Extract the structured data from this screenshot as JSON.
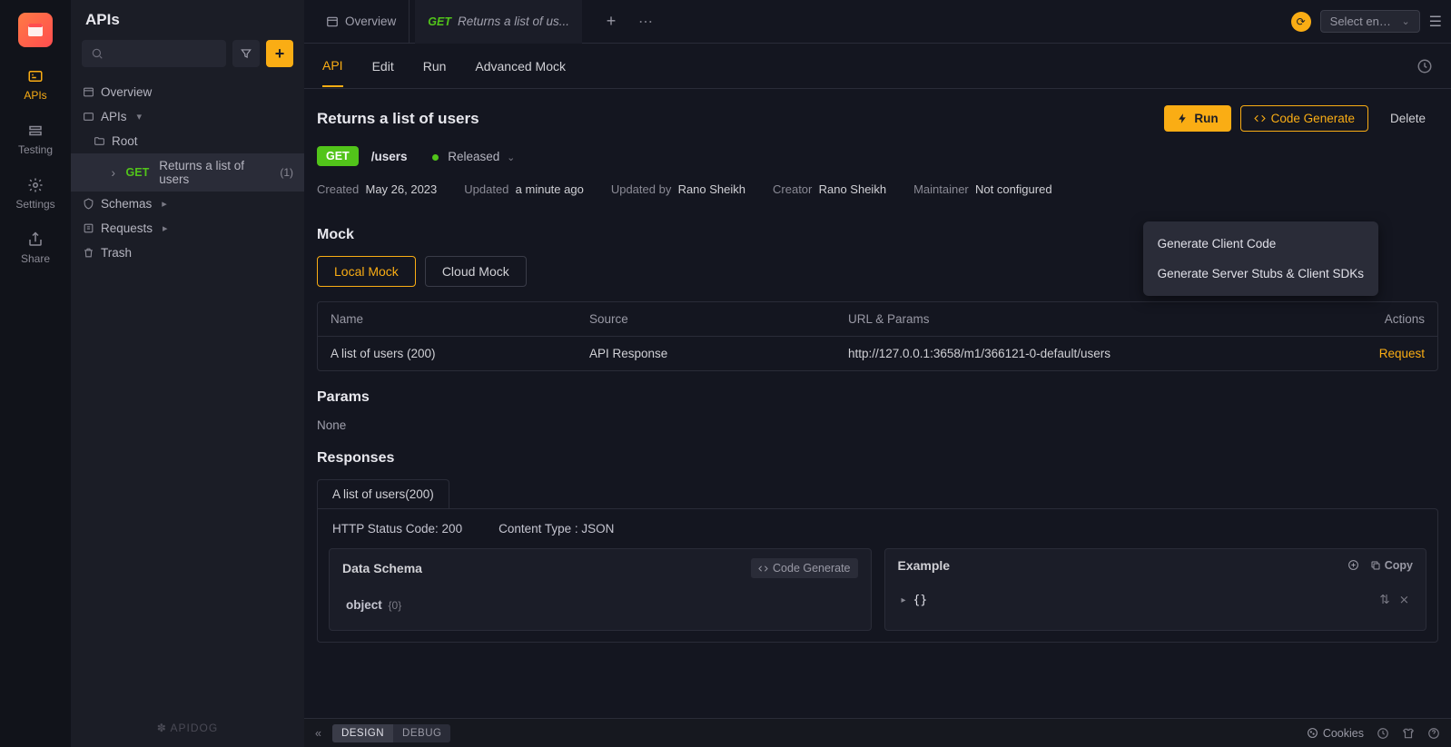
{
  "rail": {
    "items": [
      {
        "label": "APIs",
        "icon": "api"
      },
      {
        "label": "Testing",
        "icon": "testing"
      },
      {
        "label": "Settings",
        "icon": "settings"
      },
      {
        "label": "Share",
        "icon": "share"
      }
    ]
  },
  "sidebar": {
    "title": "APIs",
    "search_placeholder": "",
    "overview": "Overview",
    "apis": "APIs",
    "root": "Root",
    "endpoint_method": "GET",
    "endpoint_name": "Returns a list of users",
    "endpoint_count": "(1)",
    "schemas": "Schemas",
    "requests": "Requests",
    "trash": "Trash",
    "brand": "APIDOG"
  },
  "tabs": {
    "overview": "Overview",
    "active_method": "GET",
    "active_title": "Returns a list of us...",
    "env_placeholder": "Select envir..."
  },
  "subtabs": {
    "api": "API",
    "edit": "Edit",
    "run": "Run",
    "mock": "Advanced Mock"
  },
  "page": {
    "title": "Returns a list of users",
    "run_btn": "Run",
    "codegen_btn": "Code Generate",
    "delete_btn": "Delete",
    "method": "GET",
    "path": "/users",
    "status": "Released",
    "created_label": "Created",
    "created": "May 26, 2023",
    "updated_label": "Updated",
    "updated": "a minute ago",
    "updatedby_label": "Updated by",
    "updatedby": "Rano Sheikh",
    "creator_label": "Creator",
    "creator": "Rano Sheikh",
    "maintainer_label": "Maintainer",
    "maintainer": "Not configured"
  },
  "dropdown": {
    "item1": "Generate Client Code",
    "item2": "Generate Server Stubs & Client SDKs"
  },
  "mock": {
    "title": "Mock",
    "local": "Local Mock",
    "cloud": "Cloud Mock",
    "th_name": "Name",
    "th_source": "Source",
    "th_url": "URL & Params",
    "th_actions": "Actions",
    "row_name": "A list of users (200)",
    "row_source": "API Response",
    "row_url": "http://127.0.0.1:3658/m1/366121-0-default/users",
    "row_action": "Request"
  },
  "params": {
    "title": "Params",
    "none": "None"
  },
  "responses": {
    "title": "Responses",
    "tab": "A list of users(200)",
    "http": "HTTP Status Code: 200",
    "ctype": "Content Type : JSON",
    "schema_title": "Data Schema",
    "schema_gen": "Code Generate",
    "schema_obj": "object",
    "schema_count": "{0}",
    "example_title": "Example",
    "copy": "Copy"
  },
  "footer": {
    "design": "DESIGN",
    "debug": "DEBUG",
    "cookies": "Cookies"
  }
}
